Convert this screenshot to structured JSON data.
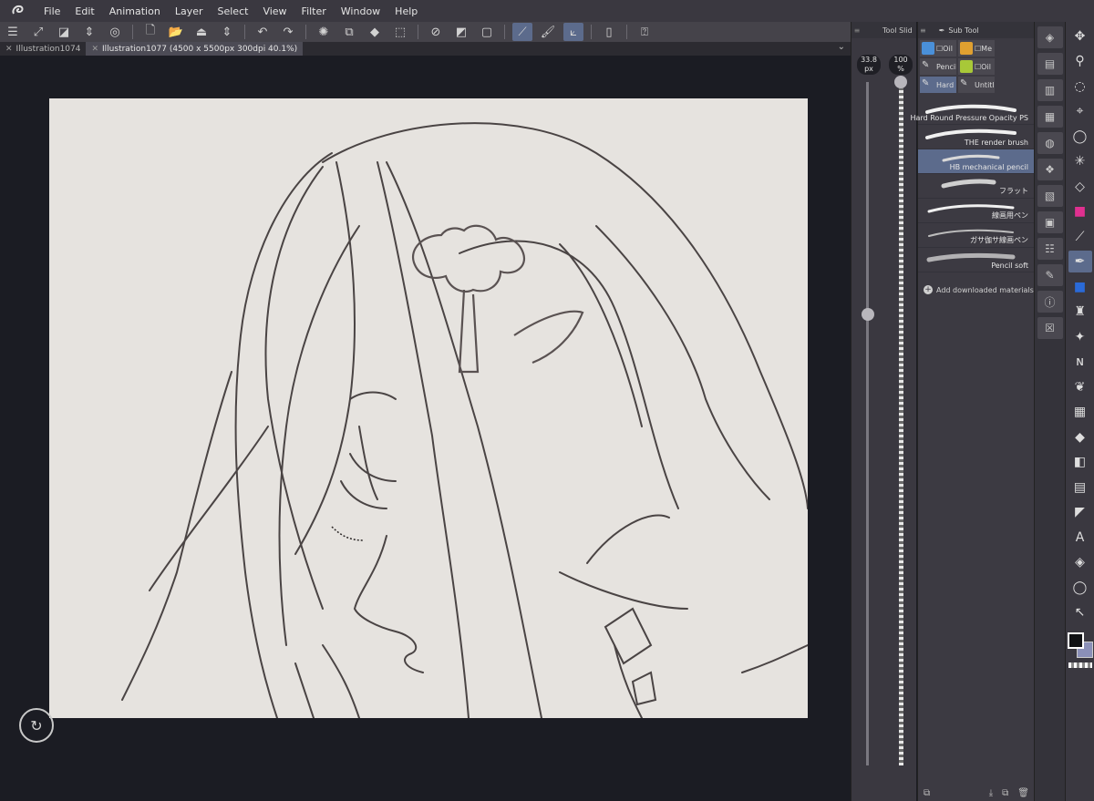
{
  "menu": {
    "items": [
      "File",
      "Edit",
      "Animation",
      "Layer",
      "Select",
      "View",
      "Filter",
      "Window",
      "Help"
    ]
  },
  "toolbar": {
    "icons": [
      "menu-icon",
      "fit-view-icon",
      "new-layer-icon",
      "reorder-icon",
      "reference-icon",
      "new-file-icon",
      "open-file-icon",
      "export-icon",
      "undo-icon",
      "redo-icon",
      "loading-icon",
      "copy-icon",
      "fill-icon",
      "transform-icon",
      "clear-icon",
      "invert-icon",
      "stabilize-icon",
      "pen-pressure-icon",
      "brush-icon",
      "ruler-icon",
      "device-icon",
      "help-icon"
    ]
  },
  "tabs": [
    {
      "label": "Illustration1074",
      "active": false
    },
    {
      "label": "Illustration1077 (4500 x 5500px 300dpi 40.1%)",
      "active": true
    }
  ],
  "tool_slider": {
    "title": "Tool Slid",
    "size_value": "33.8",
    "size_unit": "px",
    "opacity_value": "100",
    "opacity_unit": "%",
    "size_level": 0.66,
    "opacity_level": 1.0
  },
  "sub_tool": {
    "title": "Sub Tool",
    "groups": [
      {
        "label": "☐Oil",
        "color": "#4a90d9",
        "selected": false
      },
      {
        "label": "☐Me",
        "color": "#e0a030",
        "selected": false
      },
      {
        "label": "Pencil",
        "color": "",
        "selected": false
      },
      {
        "label": "☐Oil",
        "color": "#a8c838",
        "selected": false
      },
      {
        "label": "Hard",
        "color": "",
        "selected": true
      },
      {
        "label": "Untitl",
        "color": "",
        "selected": false
      }
    ],
    "brushes": [
      {
        "name": "Hard Round Pressure Opacity PS",
        "selected": false
      },
      {
        "name": "THE render brush",
        "selected": false
      },
      {
        "name": "HB mechanical pencil",
        "selected": true
      },
      {
        "name": "フラット",
        "selected": false
      },
      {
        "name": "線画用ペン",
        "selected": false
      },
      {
        "name": "ガサ伽サ線画ペン",
        "selected": false
      },
      {
        "name": "Pencil soft",
        "selected": false
      }
    ],
    "add_label": "Add downloaded materials"
  },
  "colors": {
    "accent": "#5c6b8c",
    "foreground": "#101114",
    "background": "#8b90b8",
    "paper": "#e6e3df"
  }
}
